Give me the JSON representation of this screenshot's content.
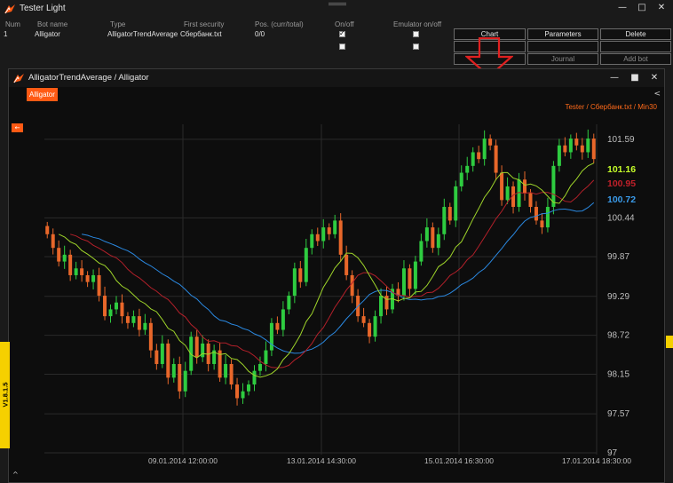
{
  "outer_window": {
    "title": "Tester Light",
    "controls": {
      "minimize": "—",
      "maximize": "□",
      "close": "✕"
    }
  },
  "bot_table": {
    "columns": [
      "Num",
      "Bot name",
      "Type",
      "First security",
      "Pos. (curr/total)",
      "On/off",
      "Emulator on/off"
    ],
    "rows": [
      {
        "num": "1",
        "bot_name": "Alligator",
        "type": "AlligatorTrendAverage",
        "security": "Сбербанк.txt",
        "position": "0/0",
        "on": true,
        "emulator": false
      }
    ]
  },
  "buttons": {
    "chart": "Chart",
    "parameters": "Parameters",
    "delete": "Delete",
    "journal": "Journal",
    "add_bot": "Add bot"
  },
  "chart_window": {
    "title": "AlligatorTrendAverage / Alligator",
    "tag": "Alligator",
    "source": "Tester / Сбербанк.txt / Min30",
    "collapse_symbol": "←",
    "side_symbol": "<",
    "controls": {
      "minimize": "—",
      "maximize": "■",
      "close": "✕"
    }
  },
  "version_label": "V1.8.1.5",
  "bottom_symbol": "^",
  "colors": {
    "up_candle": "#2ecc40",
    "down_candle": "#e8672a",
    "jaw": "#2a88e0",
    "teeth": "#b3202a",
    "lips": "#9fd52a",
    "accent": "#ff5a14",
    "label_lips": "#c6ff2a",
    "label_teeth": "#c0202a",
    "label_jaw": "#3a9ae8"
  },
  "chart_data": {
    "type": "candlestick",
    "y_ticks": [
      "101.59",
      "100.44",
      "99.87",
      "99.29",
      "98.72",
      "98.15",
      "97.57",
      "97"
    ],
    "x_ticks": [
      "09.01.2014 12:00:00",
      "13.01.2014 14:30:00",
      "15.01.2014 16:30:00",
      "17.01.2014 18:30:00"
    ],
    "last_values": [
      {
        "value": "101.16",
        "series": "lips"
      },
      {
        "value": "100.95",
        "series": "teeth"
      },
      {
        "value": "100.72",
        "series": "jaw"
      }
    ],
    "ylim": [
      97,
      101.9
    ],
    "closes": [
      100.2,
      100.0,
      99.8,
      99.9,
      99.6,
      99.7,
      99.6,
      99.5,
      99.6,
      99.3,
      99.0,
      99.1,
      99.2,
      99.0,
      98.9,
      99.0,
      98.8,
      98.9,
      98.5,
      98.3,
      98.6,
      98.1,
      98.3,
      97.9,
      98.2,
      98.7,
      98.4,
      98.6,
      98.3,
      98.5,
      98.1,
      98.3,
      98.0,
      97.8,
      97.9,
      98.0,
      98.2,
      98.3,
      98.5,
      98.9,
      98.8,
      99.1,
      99.3,
      99.7,
      99.5,
      100.0,
      100.2,
      100.1,
      100.3,
      100.2,
      100.4,
      99.9,
      99.6,
      99.3,
      99.0,
      98.9,
      98.7,
      99.0,
      99.3,
      99.1,
      99.4,
      99.3,
      99.7,
      99.4,
      99.8,
      100.1,
      100.3,
      100.0,
      100.2,
      100.6,
      100.4,
      100.9,
      101.1,
      101.2,
      101.4,
      101.3,
      101.6,
      101.5,
      101.1,
      100.7,
      100.9,
      100.6,
      101.0,
      100.8,
      100.6,
      100.4,
      100.3,
      100.6,
      101.2,
      101.5,
      101.4,
      101.6,
      101.5,
      101.4,
      101.6,
      101.3
    ]
  }
}
